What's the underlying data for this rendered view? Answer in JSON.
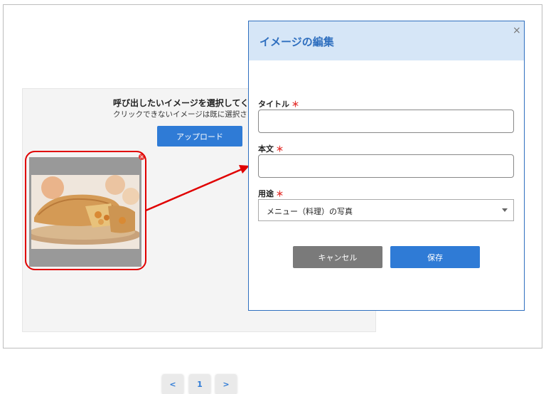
{
  "background_panel": {
    "title": "呼び出したいイメージを選択してく",
    "subtitle": "クリックできないイメージは既に選択さ",
    "upload_label": "アップロード",
    "pagination": {
      "prev": "<",
      "current": "1",
      "next": ">"
    }
  },
  "dialog": {
    "title": "イメージの編集",
    "close_label": "×",
    "fields": {
      "title_label": "タイトル",
      "body_label": "本文",
      "usage_label": "用途",
      "required_mark": "＊",
      "usage_value": "メニュー（料理）の写真"
    },
    "cancel_label": "キャンセル",
    "save_label": "保存"
  },
  "colors": {
    "accent": "#2f7bd6",
    "header_bg": "#d6e6f7",
    "annotation_red": "#e00000",
    "cancel_gray": "#7a7a7a"
  }
}
